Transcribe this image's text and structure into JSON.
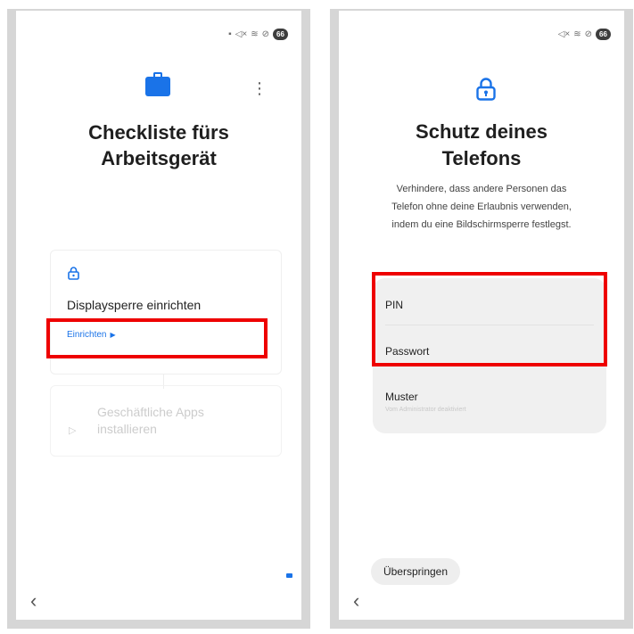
{
  "left_screen": {
    "status": {
      "battery_level": "66"
    },
    "title_line1": "Checkliste fürs",
    "title_line2": "Arbeitsgerät",
    "card_lock": {
      "label": "Displaysperre einrichten",
      "action_label": "Einrichten",
      "action_arrow": "▶"
    },
    "card_apps": {
      "label_line1": "Geschäftliche Apps",
      "label_line2": "installieren"
    },
    "nav_back": "‹",
    "menu_icon": "⋮"
  },
  "right_screen": {
    "status": {
      "battery_level": "66"
    },
    "title_line1": "Schutz deines",
    "title_line2": "Telefons",
    "description_line1": "Verhindere, dass andere Personen das",
    "description_line2": "Telefon ohne deine Erlaubnis verwenden,",
    "description_line3": "indem du eine Bildschirmsperre festlegst.",
    "options": [
      {
        "label": "PIN"
      },
      {
        "label": "Passwort"
      },
      {
        "label": "Muster",
        "sublabel": "Vom Administrator deaktiviert"
      }
    ],
    "skip_label": "Überspringen",
    "nav_back": "‹"
  },
  "colors": {
    "accent": "#1a73e8",
    "highlight": "#ee0000",
    "disabled_text": "#cccccc",
    "frame": "#d6d6d6"
  }
}
